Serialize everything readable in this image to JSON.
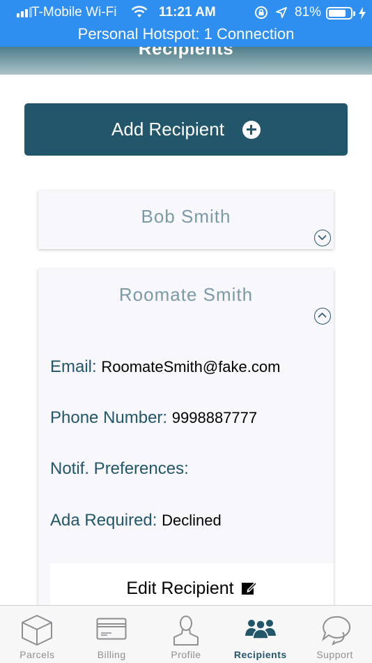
{
  "status_bar": {
    "carrier": "T-Mobile Wi-Fi",
    "time": "11:21 AM",
    "battery": "81%",
    "battery_level": 0.81,
    "hotspot": "Personal Hotspot: 1 Connection"
  },
  "header": {
    "title": "Recipients"
  },
  "add_button": {
    "label": "Add Recipient",
    "icon": "plus-circle-icon"
  },
  "recipients": [
    {
      "name": "Bob Smith",
      "expanded": false
    },
    {
      "name": "Roomate Smith",
      "expanded": true,
      "email_label": "Email:",
      "email": "RoomateSmith@fake.com",
      "phone_label": "Phone Number:",
      "phone": "9998887777",
      "notif_label": "Notif. Preferences:",
      "ada_label": "Ada Required:",
      "ada": "Declined",
      "edit_label": "Edit Recipient"
    }
  ],
  "tabs": [
    {
      "label": "Parcels",
      "icon": "box-icon"
    },
    {
      "label": "Billing",
      "icon": "card-icon"
    },
    {
      "label": "Profile",
      "icon": "person-icon"
    },
    {
      "label": "Recipients",
      "icon": "group-icon",
      "active": true
    },
    {
      "label": "Support",
      "icon": "chat-bubbles-icon"
    }
  ],
  "colors": {
    "accent": "#22566a",
    "status_bar": "#2f8ff0",
    "card_name": "#7a9aa5"
  }
}
